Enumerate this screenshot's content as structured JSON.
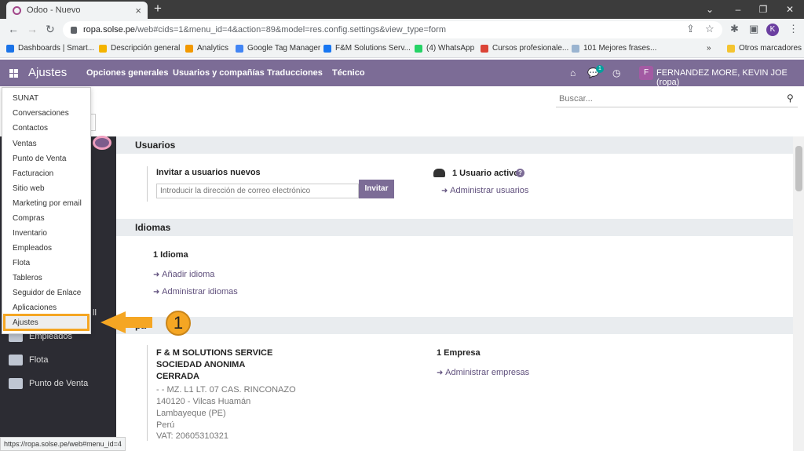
{
  "browser": {
    "tab_title": "Odoo - Nuevo",
    "new_tab": "+",
    "url_host": "ropa.solse.pe",
    "url_rest": "/web#cids=1&menu_id=4&action=89&model=res.config.settings&view_type=form",
    "profile_initial": "K",
    "bookmarks": [
      "Dashboards | Smart...",
      "Descripción general",
      "Analytics",
      "Google Tag Manager",
      "F&M Solutions Serv...",
      "(4) WhatsApp",
      "Cursos profesionale...",
      "101 Mejores frases..."
    ],
    "other_bookmarks": "Otros marcadores",
    "status_url": "https://ropa.solse.pe/web#menu_id=4"
  },
  "odoo_nav": {
    "app_title": "Ajustes",
    "menu": [
      "Opciones generales",
      "Usuarios y compañías",
      "Traducciones",
      "Técnico"
    ],
    "chat_badge": "1",
    "user_initial": "F",
    "user_name": "FERNANDEZ MORE, KEVIN JOE (ropa)"
  },
  "search": {
    "placeholder": "Buscar..."
  },
  "dropdown": {
    "items": [
      "SUNAT",
      "Conversaciones",
      "Contactos",
      "Ventas",
      "Punto de Venta",
      "Facturacion",
      "Sitio web",
      "Marketing por email",
      "Compras",
      "Inventario",
      "Empleados",
      "Flota",
      "Tableros",
      "Seguidor de Enlace",
      "Aplicaciones",
      "Ajustes"
    ],
    "selected": "Ajustes"
  },
  "sidebar": {
    "items": [
      "Empleados",
      "Flota",
      "Punto de Venta"
    ],
    "partial_text": "ll"
  },
  "annotation": {
    "step": "1"
  },
  "users_section": {
    "title": "Usuarios",
    "invite_label": "Invitar a usuarios nuevos",
    "email_placeholder": "Introducir la dirección de correo electrónico",
    "invite_button": "Invitar",
    "active_users": "1 Usuario activo",
    "manage_users": "Administrar usuarios"
  },
  "languages_section": {
    "title": "Idiomas",
    "count": "1 Idioma",
    "add_language": "Añadir idioma",
    "manage_languages": "Administrar idiomas"
  },
  "companies_section": {
    "title_partial": "pa",
    "company_name_1": "F & M SOLUTIONS SERVICE",
    "company_name_2": "SOCIEDAD ANONIMA",
    "company_name_3": "CERRADA",
    "address_1": "- - MZ. L1 LT. 07 CAS. RINCONAZO",
    "address_2": "140120 - Vilcas Huamán",
    "address_3": "Lambayeque (PE)",
    "address_4": "Perú",
    "vat": "VAT: 20605310321",
    "count": "1 Empresa",
    "manage_companies": "Administrar empresas"
  }
}
